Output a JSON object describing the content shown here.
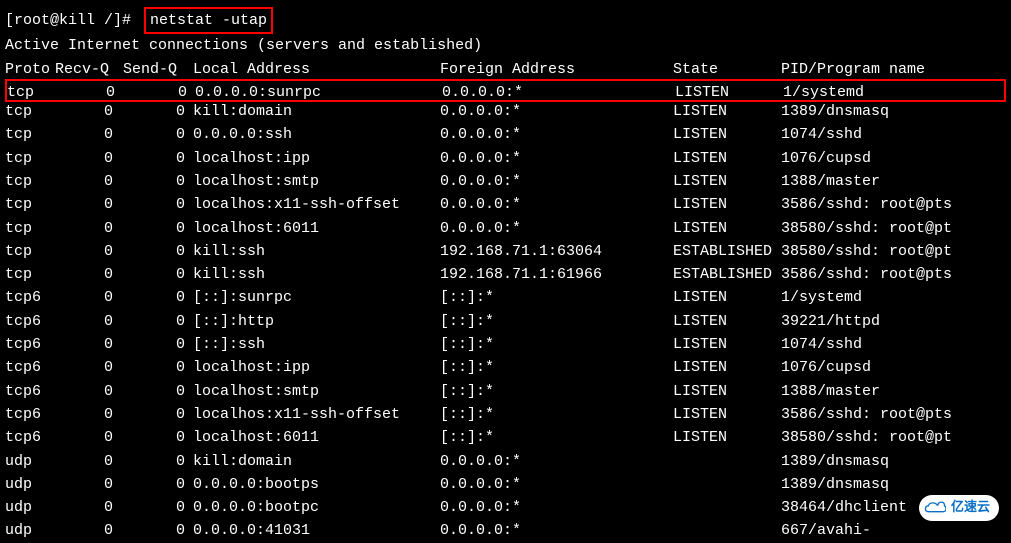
{
  "prompt": "[root@kill /]# ",
  "command": "netstat -utap",
  "subtitle": "Active Internet connections (servers and established)",
  "headers": {
    "proto": "Proto",
    "recvq": "Recv-Q",
    "sendq": "Send-Q",
    "local": "Local Address",
    "foreign": "Foreign Address",
    "state": "State",
    "pid": "PID/Program name"
  },
  "rows": [
    {
      "proto": "tcp",
      "recvq": "0",
      "sendq": "0",
      "local": "0.0.0.0:sunrpc",
      "foreign": "0.0.0.0:*",
      "state": "LISTEN",
      "pid": "1/systemd",
      "highlight": true
    },
    {
      "proto": "tcp",
      "recvq": "0",
      "sendq": "0",
      "local": "kill:domain",
      "foreign": "0.0.0.0:*",
      "state": "LISTEN",
      "pid": "1389/dnsmasq"
    },
    {
      "proto": "tcp",
      "recvq": "0",
      "sendq": "0",
      "local": "0.0.0.0:ssh",
      "foreign": "0.0.0.0:*",
      "state": "LISTEN",
      "pid": "1074/sshd"
    },
    {
      "proto": "tcp",
      "recvq": "0",
      "sendq": "0",
      "local": "localhost:ipp",
      "foreign": "0.0.0.0:*",
      "state": "LISTEN",
      "pid": "1076/cupsd"
    },
    {
      "proto": "tcp",
      "recvq": "0",
      "sendq": "0",
      "local": "localhost:smtp",
      "foreign": "0.0.0.0:*",
      "state": "LISTEN",
      "pid": "1388/master"
    },
    {
      "proto": "tcp",
      "recvq": "0",
      "sendq": "0",
      "local": "localhos:x11-ssh-offset",
      "foreign": "0.0.0.0:*",
      "state": "LISTEN",
      "pid": "3586/sshd: root@pts"
    },
    {
      "proto": "tcp",
      "recvq": "0",
      "sendq": "0",
      "local": "localhost:6011",
      "foreign": "0.0.0.0:*",
      "state": "LISTEN",
      "pid": "38580/sshd: root@pt"
    },
    {
      "proto": "tcp",
      "recvq": "0",
      "sendq": "0",
      "local": "kill:ssh",
      "foreign": "192.168.71.1:63064",
      "state": "ESTABLISHED",
      "pid": "38580/sshd: root@pt"
    },
    {
      "proto": "tcp",
      "recvq": "0",
      "sendq": "0",
      "local": "kill:ssh",
      "foreign": "192.168.71.1:61966",
      "state": "ESTABLISHED",
      "pid": "3586/sshd: root@pts"
    },
    {
      "proto": "tcp6",
      "recvq": "0",
      "sendq": "0",
      "local": "[::]:sunrpc",
      "foreign": "[::]:*",
      "state": "LISTEN",
      "pid": "1/systemd"
    },
    {
      "proto": "tcp6",
      "recvq": "0",
      "sendq": "0",
      "local": "[::]:http",
      "foreign": "[::]:*",
      "state": "LISTEN",
      "pid": "39221/httpd"
    },
    {
      "proto": "tcp6",
      "recvq": "0",
      "sendq": "0",
      "local": "[::]:ssh",
      "foreign": "[::]:*",
      "state": "LISTEN",
      "pid": "1074/sshd"
    },
    {
      "proto": "tcp6",
      "recvq": "0",
      "sendq": "0",
      "local": "localhost:ipp",
      "foreign": "[::]:*",
      "state": "LISTEN",
      "pid": "1076/cupsd"
    },
    {
      "proto": "tcp6",
      "recvq": "0",
      "sendq": "0",
      "local": "localhost:smtp",
      "foreign": "[::]:*",
      "state": "LISTEN",
      "pid": "1388/master"
    },
    {
      "proto": "tcp6",
      "recvq": "0",
      "sendq": "0",
      "local": "localhos:x11-ssh-offset",
      "foreign": "[::]:*",
      "state": "LISTEN",
      "pid": "3586/sshd: root@pts"
    },
    {
      "proto": "tcp6",
      "recvq": "0",
      "sendq": "0",
      "local": "localhost:6011",
      "foreign": "[::]:*",
      "state": "LISTEN",
      "pid": "38580/sshd: root@pt"
    },
    {
      "proto": "udp",
      "recvq": "0",
      "sendq": "0",
      "local": "kill:domain",
      "foreign": "0.0.0.0:*",
      "state": "",
      "pid": "1389/dnsmasq"
    },
    {
      "proto": "udp",
      "recvq": "0",
      "sendq": "0",
      "local": "0.0.0.0:bootps",
      "foreign": "0.0.0.0:*",
      "state": "",
      "pid": "1389/dnsmasq"
    },
    {
      "proto": "udp",
      "recvq": "0",
      "sendq": "0",
      "local": "0.0.0.0:bootpc",
      "foreign": "0.0.0.0:*",
      "state": "",
      "pid": "38464/dhclient"
    },
    {
      "proto": "udp",
      "recvq": "0",
      "sendq": "0",
      "local": "0.0.0.0:41031",
      "foreign": "0.0.0.0:*",
      "state": "",
      "pid": "667/avahi-"
    }
  ],
  "watermark": "亿速云"
}
